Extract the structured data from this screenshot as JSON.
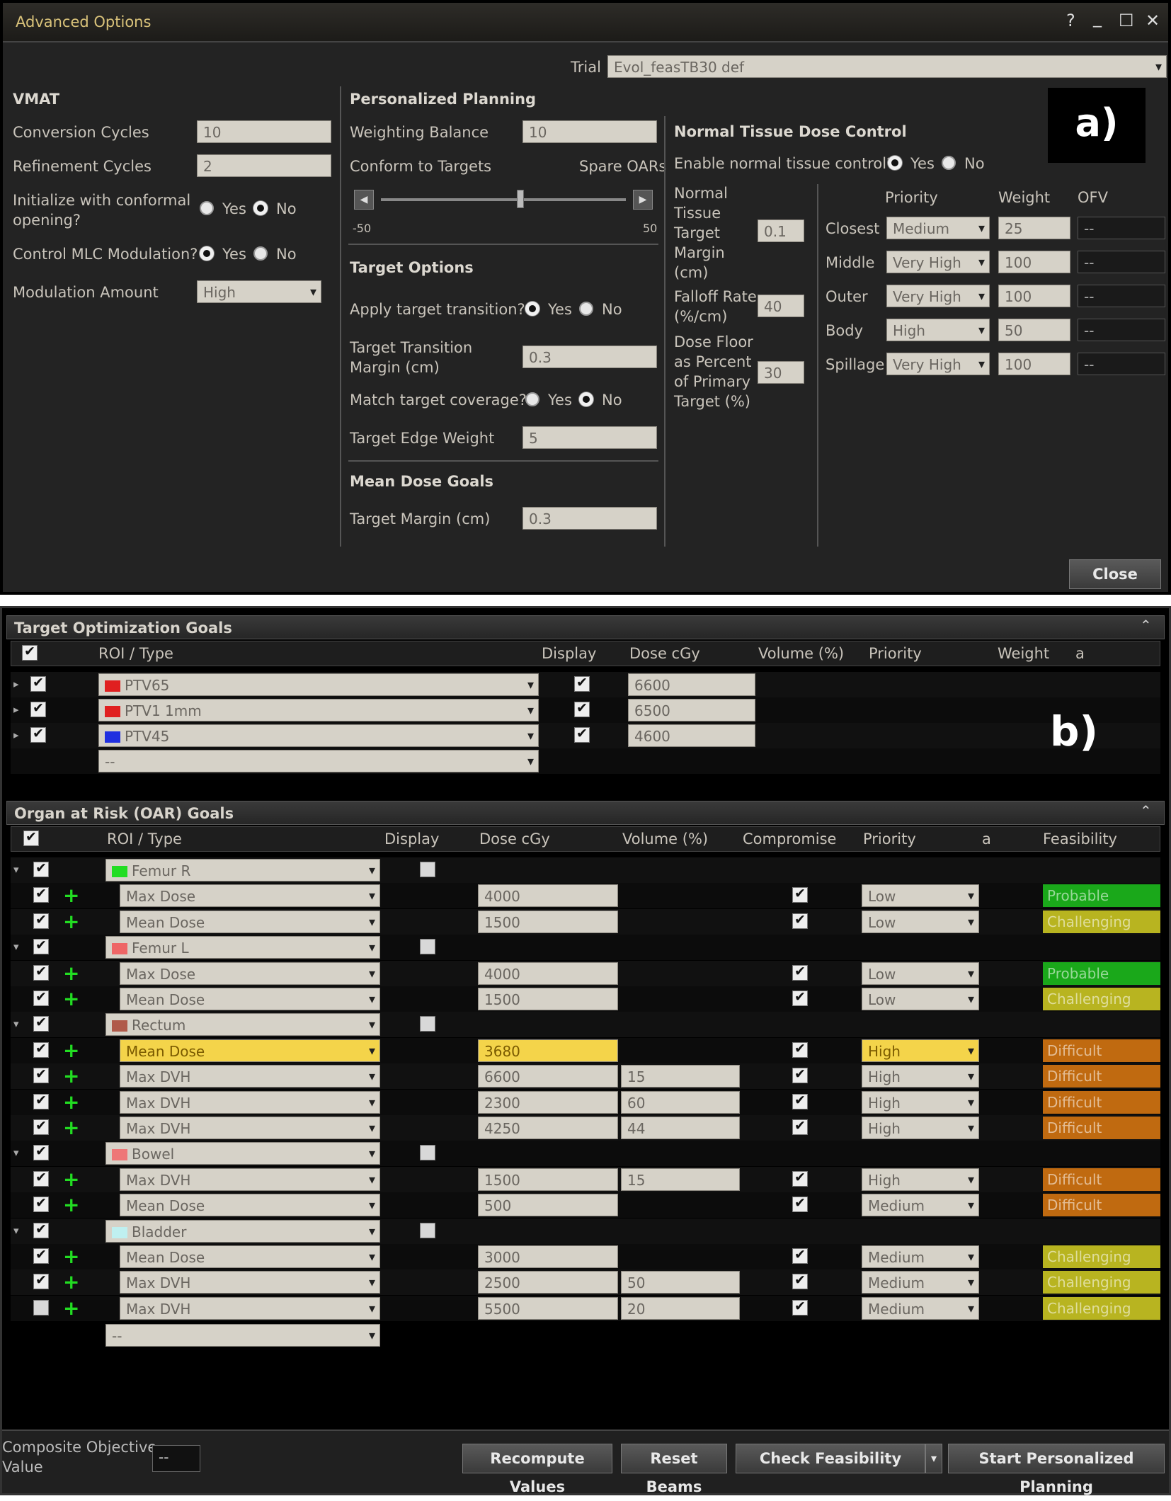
{
  "panel_a": {
    "window_title": "Advanced Options",
    "title_controls": [
      "?",
      "_",
      "☐",
      "✕"
    ],
    "trial_label": "Trial",
    "trial_value": "Evol_feasTB30 def",
    "tag": "a)",
    "vmat": {
      "title": "VMAT",
      "conversion_label": "Conversion Cycles",
      "conversion_value": "10",
      "refinement_label": "Refinement Cycles",
      "refinement_value": "2",
      "init_label_1": "Initialize with conformal",
      "init_label_2": "opening?",
      "control_mlc_label": "Control MLC Modulation?",
      "modulation_label": "Modulation Amount",
      "modulation_value": "High"
    },
    "yes": "Yes",
    "no": "No",
    "personalized": {
      "title": "Personalized Planning",
      "weighting_label": "Weighting Balance",
      "weighting_value": "10",
      "conform_label": "Conform to Targets",
      "spare_label": "Spare OARs",
      "slider_min": "-50",
      "slider_max": "50",
      "slider_position": 0.57
    },
    "target_options": {
      "title": "Target Options",
      "apply_label": "Apply target transition?",
      "margin_label_1": "Target Transition",
      "margin_label_2": "Margin (cm)",
      "margin_value": "0.3",
      "match_label": "Match target coverage?",
      "edge_label": "Target Edge Weight",
      "edge_value": "5"
    },
    "mean_dose": {
      "title": "Mean Dose Goals",
      "margin_label": "Target Margin (cm)",
      "margin_value": "0.3"
    },
    "ntdc": {
      "title": "Normal Tissue Dose Control",
      "enable_label": "Enable normal tissue control?",
      "ntm_label": [
        "Normal",
        "Tissue",
        "Target",
        "Margin",
        "(cm)"
      ],
      "ntm_value": "0.1",
      "falloff_label": [
        "Falloff Rate",
        "(%/cm)"
      ],
      "falloff_value": "40",
      "floor_label": [
        "Dose Floor",
        "as Percent",
        "of Primary",
        "Target (%)"
      ],
      "floor_value": "30",
      "col_priority": "Priority",
      "col_weight": "Weight",
      "col_ofv": "OFV",
      "rows": [
        {
          "name": "Closest",
          "priority": "Medium",
          "weight": "25",
          "ofv": "--"
        },
        {
          "name": "Middle",
          "priority": "Very High",
          "weight": "100",
          "ofv": "--"
        },
        {
          "name": "Outer",
          "priority": "Very High",
          "weight": "100",
          "ofv": "--"
        },
        {
          "name": "Body",
          "priority": "High",
          "weight": "50",
          "ofv": "--"
        },
        {
          "name": "Spillage",
          "priority": "Very High",
          "weight": "100",
          "ofv": "--"
        }
      ]
    },
    "close_label": "Close"
  },
  "panel_b": {
    "tag": "b)",
    "target_title": "Target Optimization Goals",
    "target_cols": {
      "roi": "ROI / Type",
      "display": "Display",
      "dose": "Dose cGy",
      "volume": "Volume (%)",
      "priority": "Priority",
      "weight": "Weight",
      "a": "a"
    },
    "targets": [
      {
        "name": "PTV65",
        "color": "#e02020",
        "dose": "6600"
      },
      {
        "name": "PTV1 1mm",
        "color": "#e02020",
        "dose": "6500"
      },
      {
        "name": "PTV45",
        "color": "#2030e0",
        "dose": "4600"
      }
    ],
    "target_empty": "--",
    "oar_title": "Organ at Risk (OAR) Goals",
    "oar_cols": {
      "roi": "ROI / Type",
      "display": "Display",
      "dose": "Dose cGy",
      "volume": "Volume (%)",
      "compromise": "Compromise",
      "priority": "Priority",
      "a": "a",
      "feasibility": "Feasibility"
    },
    "oar_rows": [
      {
        "kind": "organ",
        "name": "Femur R",
        "color": "#22dd22"
      },
      {
        "kind": "goal",
        "checked": true,
        "type": "Max Dose",
        "dose": "4000",
        "volume": "",
        "priority": "Low",
        "feas": "Probable",
        "feas_color": "#1aa81a"
      },
      {
        "kind": "goal",
        "checked": true,
        "type": "Mean Dose",
        "dose": "1500",
        "volume": "",
        "priority": "Low",
        "feas": "Challenging",
        "feas_color": "#b8b420"
      },
      {
        "kind": "organ",
        "name": "Femur L",
        "color": "#ee6666"
      },
      {
        "kind": "goal",
        "checked": true,
        "type": "Max Dose",
        "dose": "4000",
        "volume": "",
        "priority": "Low",
        "feas": "Probable",
        "feas_color": "#1aa81a"
      },
      {
        "kind": "goal",
        "checked": true,
        "type": "Mean Dose",
        "dose": "1500",
        "volume": "",
        "priority": "Low",
        "feas": "Challenging",
        "feas_color": "#b8b420"
      },
      {
        "kind": "organ",
        "name": "Rectum",
        "color": "#b05a4a"
      },
      {
        "kind": "goal",
        "checked": true,
        "type": "Mean Dose",
        "dose": "3680",
        "volume": "",
        "priority": "High",
        "feas": "Difficult",
        "feas_color": "#c06a10",
        "highlight": true
      },
      {
        "kind": "goal",
        "checked": true,
        "type": "Max DVH",
        "dose": "6600",
        "volume": "15",
        "priority": "High",
        "feas": "Difficult",
        "feas_color": "#c06a10"
      },
      {
        "kind": "goal",
        "checked": true,
        "type": "Max DVH",
        "dose": "2300",
        "volume": "60",
        "priority": "High",
        "feas": "Difficult",
        "feas_color": "#c06a10"
      },
      {
        "kind": "goal",
        "checked": true,
        "type": "Max DVH",
        "dose": "4250",
        "volume": "44",
        "priority": "High",
        "feas": "Difficult",
        "feas_color": "#c06a10"
      },
      {
        "kind": "organ",
        "name": "Bowel",
        "color": "#ee7777"
      },
      {
        "kind": "goal",
        "checked": true,
        "type": "Max DVH",
        "dose": "1500",
        "volume": "15",
        "priority": "High",
        "feas": "Difficult",
        "feas_color": "#c06a10"
      },
      {
        "kind": "goal",
        "checked": true,
        "type": "Mean Dose",
        "dose": "500",
        "volume": "",
        "priority": "Medium",
        "feas": "Difficult",
        "feas_color": "#c06a10"
      },
      {
        "kind": "organ",
        "name": "Bladder",
        "color": "#bff0f0"
      },
      {
        "kind": "goal",
        "checked": true,
        "type": "Mean Dose",
        "dose": "3000",
        "volume": "",
        "priority": "Medium",
        "feas": "Challenging",
        "feas_color": "#b8b420"
      },
      {
        "kind": "goal",
        "checked": true,
        "type": "Max DVH",
        "dose": "2500",
        "volume": "50",
        "priority": "Medium",
        "feas": "Challenging",
        "feas_color": "#b8b420"
      },
      {
        "kind": "goal",
        "checked": false,
        "type": "Max DVH",
        "dose": "5500",
        "volume": "20",
        "priority": "Medium",
        "feas": "Challenging",
        "feas_color": "#b8b420"
      }
    ],
    "oar_empty": "--",
    "composite_label_1": "Composite Objective",
    "composite_label_2": "Value",
    "composite_value": "--",
    "buttons": {
      "recompute": "Recompute Values",
      "reset": "Reset Beams",
      "check": "Check Feasibility",
      "start": "Start Personalized Planning"
    }
  }
}
